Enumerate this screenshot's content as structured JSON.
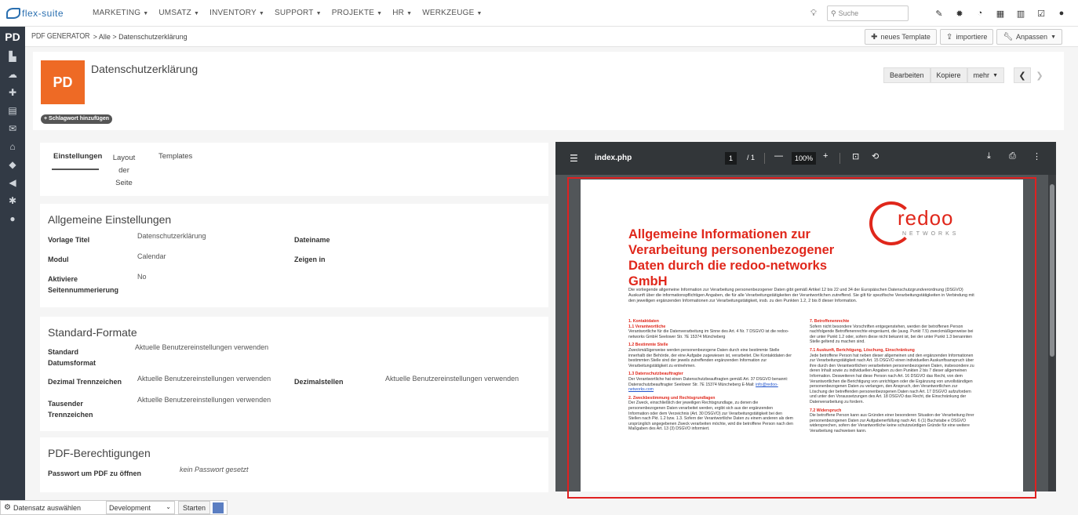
{
  "app": {
    "logo_text": "flex-suite",
    "menu": [
      "MARKETING",
      "UMSATZ",
      "INVENTORY",
      "SUPPORT",
      "PROJEKTE",
      "HR",
      "WERKZEUGE"
    ],
    "search_placeholder": "Suche",
    "module_badge": "PD"
  },
  "breadcrumb": {
    "module": "PDF GENERATOR",
    "path": " > Alle > Datenschutzerklärung",
    "buttons": {
      "new_template": "neues Template",
      "import": "importiere",
      "customize": "Anpassen"
    }
  },
  "record": {
    "icon_text": "PD",
    "title": "Datenschutzerklärung",
    "tag_button": "+ Schlagwort hinzufügen",
    "buttons": {
      "edit": "Bearbeiten",
      "copy": "Kopiere",
      "more": "mehr"
    }
  },
  "tabs": {
    "settings": "Einstellungen",
    "layout": "Layout",
    "layout2": "der",
    "layout3": "Seite",
    "templates": "Templates"
  },
  "general": {
    "title": "Allgemeine Einstellungen",
    "vorlage_label": "Vorlage Titel",
    "vorlage_value": "Datenschutzerklärung",
    "dateiname_label": "Dateiname",
    "modul_label": "Modul",
    "modul_value": "Calendar",
    "zeigen_label": "Zeigen in",
    "aktiv_label1": "Aktiviere",
    "aktiv_label2": "Seitennummerierung",
    "aktiv_value": "No"
  },
  "formats": {
    "title": "Standard-Formate",
    "datum_label1": "Standard",
    "datum_label2": "Datumsformat",
    "datum_value": "Aktuelle Benutzereinstellungen verwenden",
    "dezimal_label": "Dezimal Trennzeichen",
    "dezimal_value": "Aktuelle Benutzereinstellungen verwenden",
    "stellen_label": "Dezimalstellen",
    "stellen_value": "Aktuelle Benutzereinstellungen verwenden",
    "tausend_label1": "Tausender",
    "tausend_label2": "Trennzeichen",
    "tausend_value": "Aktuelle Benutzereinstellungen verwenden"
  },
  "permissions": {
    "title": "PDF-Berechtigungen",
    "pw_label": "Passwort um PDF zu öffnen",
    "pw_value": "kein Passwort gesetzt"
  },
  "viewer": {
    "filename": "index.php",
    "page": "1",
    "total": "/ 1",
    "zoom": "100%"
  },
  "pdf": {
    "heading": "Allgemeine Informationen zur Verarbeitung personenbezogener Daten durch die redoo-networks GmbH",
    "logo_main": "redoo",
    "logo_sub": "NETWORKS",
    "intro": "Die vorliegende allgemeine Information zur Verarbeitung personenbezogener Daten gibt gemäß Artikel 12 bis 22 und 34 der Europäischen Datenschutzgrundverordnung (DSGVO) Auskunft über die informationspflichtigen Angaben, die für alle Verarbeitungstätigkeiten der Verantwortlichen zutreffend. Sie gilt für spezifische Verarbeitungstätigkeiten in Verbindung mit den jeweiligen ergänzenden Informationen zur Verarbeitungstätigkeit, insb. zu den Punkten 1.2, 2 bis 8 dieser Information.",
    "s1": "1. Kontaktdaten",
    "s11": "1.1 Verantwortliche",
    "t11": "Verantwortliche für die Datenverarbeitung im Sinne des Art. 4 Nr. 7 DSGVO ist die redoo-networks GmbH Seelower Str. 7E 15374 Müncheberg",
    "s12": "1.2 Bestimmte Stelle",
    "t12": "Zweckmäßigerweise werden personenbezogene Daten durch eine bestimmte Stelle innerhalb der Behörde, der eine Aufgabe zugewiesen ist, verarbeitet. Die Kontaktdaten der bestimmten Stelle sind der jeweils zutreffenden ergänzenden Information zur Verarbeitungstätigkeit zu entnehmen.",
    "s13": "1.3 Datenschutzbeauftragter",
    "t13": "Der Verantwortliche hat einen Datenschutzbeauftragten gemäß Art. 37 DSGVO benannt: Datenschutzbeauftragter Seelower Str. 7E 15374 Müncheberg E-Mail:",
    "t13link": "info@redoo-networks.com",
    "s2": "2. Zweckbestimmung und Rechtsgrundlagen",
    "t2": "Der Zweck, einschließlich der jeweiligen Rechtsgrundlage, zu denen die personenbezogenen Daten verarbeitet werden, ergibt sich aus der ergänzenden Information oder dem Verzeichnis (Art. 30 DSGVO) zur Verarbeitungstätigkeit bei den Stellen nach Pkt. 1.2 bzw. 1.3. Sofern der Verantwortliche Daten zu einem anderen als dem ursprünglich angegebenen Zweck verarbeiten möchte, wird die betroffene Person nach den Maßgaben des Art. 13 (3) DSGVO informiert.",
    "s7": "7. Betroffenenrechte",
    "t7": "Sofern nicht besondere Vorschriften entgegenstehen, werden der betroffenen Person nachfolgende Betroffenenrechte eingeräumt, die (ausg. Punkt 7.5) zweckmäßigerweise bei der unter Punkt 1.2 oder, sofern diese nicht bekannt ist, bei der unter Punkt 1.3 benannten Stelle geltend zu machen sind.",
    "s71": "7.1 Auskunft, Berichtigung, Löschung, Einschränkung",
    "t71": "Jede betroffene Person hat neben dieser allgemeinen und den ergänzenden Informationen zur Verarbeitungstätigkeit nach Art. 15 DSGVO einen individuellen Auskunftsanspruch über ihre durch den Verantwortlichen verarbeiteten personenbezogenen Daten, insbesondere zu deren Inhalt sowie zu individuellen Angaben zu den Punkten 2 bis 7 dieser allgemeinen Information. Desweiteren hat diese Person nach Art. 16 DSGVO das Recht, von dem Verantwortlichen die Berichtigung von unrichtigen oder die Ergänzung von unvollständigen personenbezogenen Daten zu verlangen, den Anspruch, den Verantwortlichen zur Löschung der betreffenden personenbezogenen Daten nach Art. 17 DSGVO aufzufordern und unter den Voraussetzungen des Art. 18 DSGVO das Recht, die Einschränkung der Datenverarbeitung zu fordern.",
    "s72": "7.2 Widerspruch",
    "t72": "Die betroffene Person kann aus Gründen einer besonderen Situation der Verarbeitung ihrer personenbezogenen Daten zur Aufgabenerfüllung nach Art. 6 (1) Buchstabe e DSGVO widersprechen, sofern der Verantwortliche keine schutzwürdigen Gründe für eine weitere Verarbeitung nachweisen kann."
  },
  "bottom": {
    "label": "Datensatz auswählen",
    "select": "Development",
    "start": "Starten"
  }
}
